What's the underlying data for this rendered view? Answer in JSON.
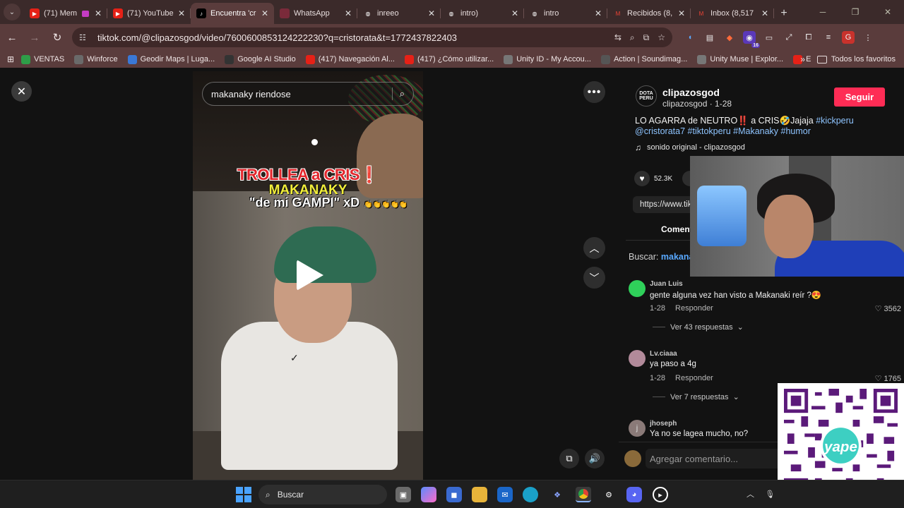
{
  "browser": {
    "tabs": [
      {
        "title": "(71) Mem",
        "favicon": "youtube-icon",
        "active": false,
        "muted_badge": true
      },
      {
        "title": "(71) YouTube",
        "favicon": "youtube-icon",
        "active": false
      },
      {
        "title": "Encuentra 'cr",
        "favicon": "tiktok-icon",
        "active": true
      },
      {
        "title": "WhatsApp",
        "favicon": "whatsapp-icon",
        "active": false
      },
      {
        "title": "inreeo",
        "favicon": "globe-icon",
        "active": false
      },
      {
        "title": "intro)",
        "favicon": "globe-icon",
        "active": false
      },
      {
        "title": "intro",
        "favicon": "globe-icon",
        "active": false
      },
      {
        "title": "Recibidos (8,",
        "favicon": "gmail-icon",
        "active": false
      },
      {
        "title": "Inbox (8,517",
        "favicon": "gmail-icon",
        "active": false
      }
    ],
    "url": "tiktok.com/@clipazosgod/video/7600600853124222230?q=cristorata&t=1772437822403",
    "extension_badge": "16",
    "profile_initial": "G",
    "bookmarks": [
      {
        "label": "VENTAS",
        "color": "#2e9d48"
      },
      {
        "label": "Winforce",
        "color": "#6a6a6a"
      },
      {
        "label": "Geodir Maps | Luga...",
        "color": "#3a78d6"
      },
      {
        "label": "Google AI Studio",
        "color": "#333333"
      },
      {
        "label": "(417) Navegación Al...",
        "color": "#e62117"
      },
      {
        "label": "(417) ¿Cómo utilizar...",
        "color": "#e62117"
      },
      {
        "label": "Unity ID - My Accou...",
        "color": "#777777"
      },
      {
        "label": "Action | Soundimag...",
        "color": "#555555"
      },
      {
        "label": "Unity Muse | Explor...",
        "color": "#777777"
      },
      {
        "label": "E",
        "color": "#e62117"
      }
    ],
    "bookmarks_more": "»",
    "all_bookmarks": "Todos los favoritos"
  },
  "video": {
    "search_query": "makanaky riendose",
    "overlay_line1": "TROLLEA a CRIS❗",
    "overlay_line2": "MAKANAKY",
    "overlay_line3": "\"de mi GAMPI\" xD",
    "overlay_emoji": "👏👏👏👏👏"
  },
  "post": {
    "avatar_text": "DOTA PERU",
    "username": "clipazosgod",
    "handle_date": "clipazosgod · 1-28",
    "follow_label": "Seguir",
    "desc_text": "LO AGARRA de NEUTRO‼️ a CRIS🤣Jajaja",
    "desc_tags_1": "#kickperu",
    "desc_tags_2": "@cristorata7 #tiktokperu #Makanaky #humor",
    "sound": "sonido original - clipazosgod",
    "likes": "52.3K",
    "link": "https://www.tik",
    "comments_tab": "Coment",
    "buscar_label": "Buscar:",
    "buscar_query": "makana"
  },
  "comments": [
    {
      "name": "Juan Luis",
      "text": "gente alguna vez han visto a Makanaki reír ?😍",
      "date": "1-28",
      "reply": "Responder",
      "likes": "3562",
      "replies": "Ver 43 respuestas",
      "avatar_color": "#2fd05a"
    },
    {
      "name": "Lv.ciaaa",
      "text": "ya paso a 4g",
      "date": "1-28",
      "reply": "Responder",
      "likes": "1765",
      "replies": "Ver 7 respuestas",
      "avatar_color": "#b28a9a"
    },
    {
      "name": "jhoseph",
      "text": "Ya no se lagea mucho, no?",
      "avatar_color": "#8a7a78",
      "avatar_letter": "j"
    }
  ],
  "add_comment_placeholder": "Agregar comentario...",
  "taskbar": {
    "search_label": "Buscar"
  }
}
